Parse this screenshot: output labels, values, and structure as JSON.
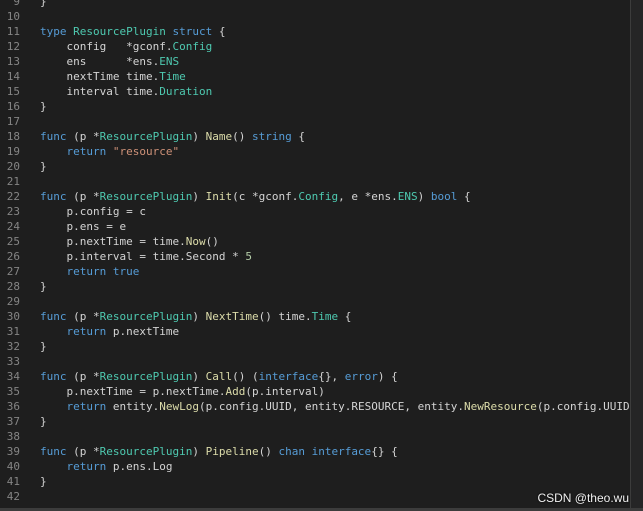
{
  "editor": {
    "lines": [
      {
        "n": "9",
        "code": "}"
      },
      {
        "n": "10",
        "code": ""
      },
      {
        "n": "11",
        "code": "type ResourcePlugin struct {"
      },
      {
        "n": "12",
        "code": "    config   *gconf.Config"
      },
      {
        "n": "13",
        "code": "    ens      *ens.ENS"
      },
      {
        "n": "14",
        "code": "    nextTime time.Time"
      },
      {
        "n": "15",
        "code": "    interval time.Duration"
      },
      {
        "n": "16",
        "code": "}"
      },
      {
        "n": "17",
        "code": ""
      },
      {
        "n": "18",
        "code": "func (p *ResourcePlugin) Name() string {"
      },
      {
        "n": "19",
        "code": "    return \"resource\""
      },
      {
        "n": "20",
        "code": "}"
      },
      {
        "n": "21",
        "code": ""
      },
      {
        "n": "22",
        "code": "func (p *ResourcePlugin) Init(c *gconf.Config, e *ens.ENS) bool {"
      },
      {
        "n": "23",
        "code": "    p.config = c"
      },
      {
        "n": "24",
        "code": "    p.ens = e"
      },
      {
        "n": "25",
        "code": "    p.nextTime = time.Now()"
      },
      {
        "n": "26",
        "code": "    p.interval = time.Second * 5"
      },
      {
        "n": "27",
        "code": "    return true"
      },
      {
        "n": "28",
        "code": "}"
      },
      {
        "n": "29",
        "code": ""
      },
      {
        "n": "30",
        "code": "func (p *ResourcePlugin) NextTime() time.Time {"
      },
      {
        "n": "31",
        "code": "    return p.nextTime"
      },
      {
        "n": "32",
        "code": "}"
      },
      {
        "n": "33",
        "code": ""
      },
      {
        "n": "34",
        "code": "func (p *ResourcePlugin) Call() (interface{}, error) {"
      },
      {
        "n": "35",
        "code": "    p.nextTime = p.nextTime.Add(p.interval)"
      },
      {
        "n": "36",
        "code": "    return entity.NewLog(p.config.UUID, entity.RESOURCE, entity.NewResource(p.config.UUID)), nil"
      },
      {
        "n": "37",
        "code": "}"
      },
      {
        "n": "38",
        "code": ""
      },
      {
        "n": "39",
        "code": "func (p *ResourcePlugin) Pipeline() chan interface{} {"
      },
      {
        "n": "40",
        "code": "    return p.ens.Log"
      },
      {
        "n": "41",
        "code": "}"
      },
      {
        "n": "42",
        "code": ""
      }
    ]
  },
  "watermark": "CSDN @theo.wu"
}
